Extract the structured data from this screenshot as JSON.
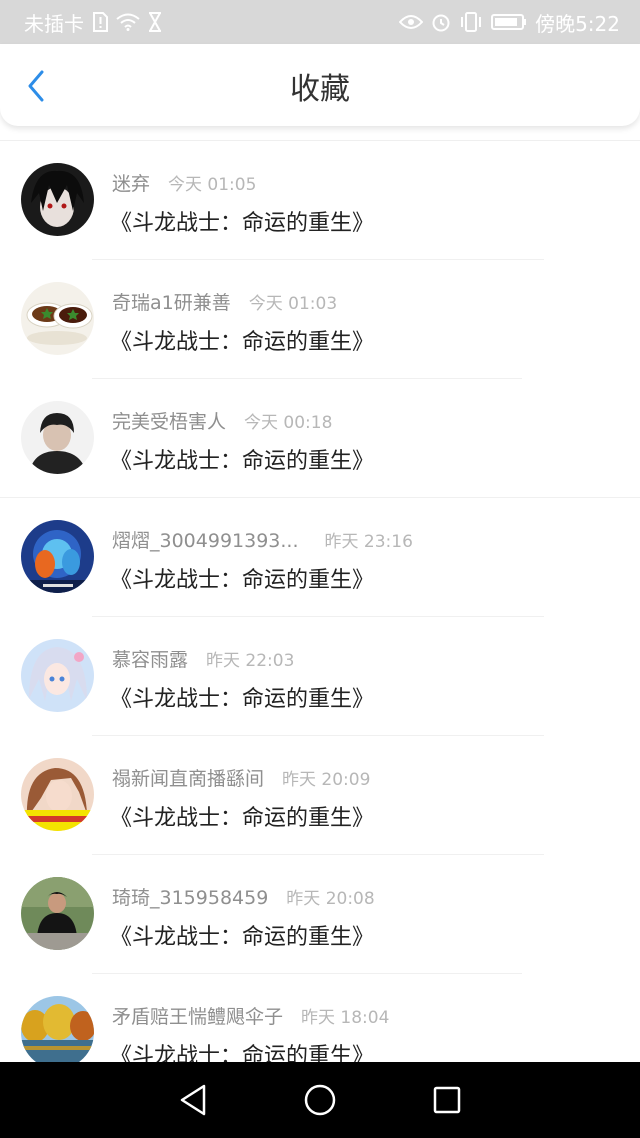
{
  "status_bar": {
    "carrier": "未插卡",
    "time": "傍晚5:22",
    "left_icons": [
      "sim-alert-icon",
      "wifi-icon",
      "hourglass-icon"
    ],
    "right_icons": [
      "eye-icon",
      "alarm-icon",
      "vibrate-icon",
      "battery-icon"
    ]
  },
  "header": {
    "title": "收藏",
    "back_icon": "chevron-left-icon",
    "accent_color": "#2d8de8"
  },
  "favorites": [
    {
      "user": "迷弃",
      "time": "今天 01:05",
      "title": "《斗龙战士：命运的重生》"
    },
    {
      "user": "奇瑞a1研兼善",
      "time": "今天 01:03",
      "title": "《斗龙战士：命运的重生》"
    },
    {
      "user": "完美受梧害人",
      "time": "今天 00:18",
      "title": "《斗龙战士：命运的重生》"
    },
    {
      "user": "熠熠_3004991393...",
      "time": "昨天 23:16",
      "title": "《斗龙战士：命运的重生》"
    },
    {
      "user": "慕容雨露",
      "time": "昨天 22:03",
      "title": "《斗龙战士：命运的重生》"
    },
    {
      "user": "禢新闻直啇播繇间",
      "time": "昨天 20:09",
      "title": "《斗龙战士：命运的重生》"
    },
    {
      "user": "琦琦_315958459",
      "time": "昨天 20:08",
      "title": "《斗龙战士：命运的重生》"
    },
    {
      "user": "矛盾赔王惴鳢飓伞子",
      "time": "昨天 18:04",
      "title": "《斗龙战士：命运的重生》"
    }
  ],
  "nav_bar": {
    "icons": [
      "back-triangle-icon",
      "home-circle-icon",
      "recents-square-icon"
    ]
  }
}
